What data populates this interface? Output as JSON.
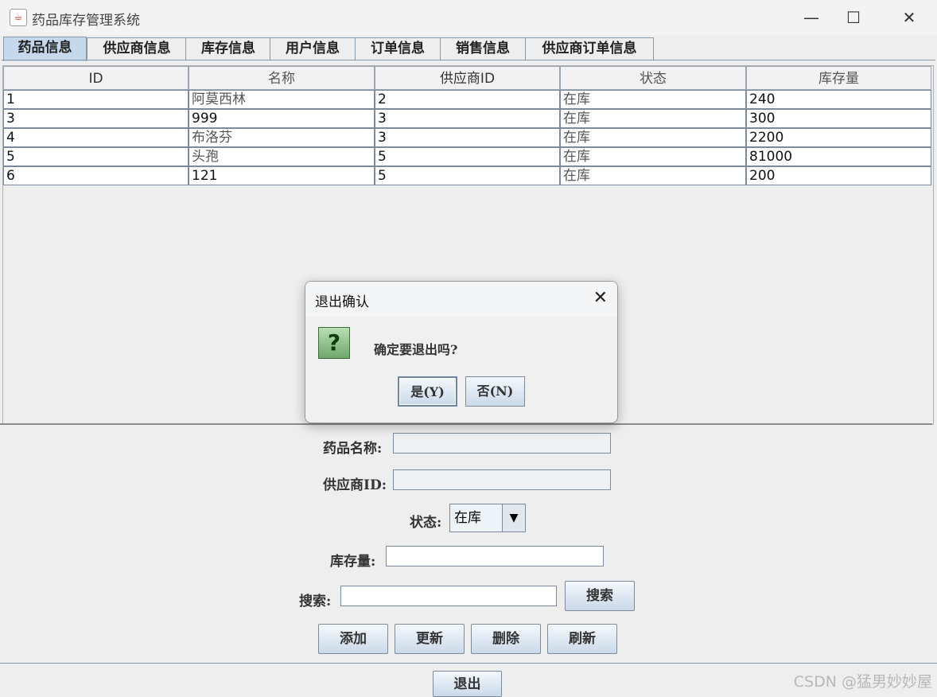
{
  "window": {
    "title": "药品库存管理系统",
    "minimize": "—",
    "maximize": "☐",
    "close": "✕"
  },
  "tabs": [
    "药品信息",
    "供应商信息",
    "库存信息",
    "用户信息",
    "订单信息",
    "销售信息",
    "供应商订单信息"
  ],
  "active_tab": "药品信息",
  "table": {
    "headers": [
      "ID",
      "名称",
      "供应商ID",
      "状态",
      "库存量"
    ],
    "rows": [
      [
        "1",
        "阿莫西林",
        "2",
        "在库",
        "240"
      ],
      [
        "3",
        "999",
        "3",
        "在库",
        "300"
      ],
      [
        "4",
        "布洛芬",
        "3",
        "在库",
        "2200"
      ],
      [
        "5",
        "头孢",
        "5",
        "在库",
        "81000"
      ],
      [
        "6",
        "121",
        "5",
        "在库",
        "200"
      ]
    ]
  },
  "form": {
    "name_label": "药品名称:",
    "supplier_label": "供应商ID:",
    "status_label": "状态:",
    "status_value": "在库",
    "stock_label": "库存量:",
    "search_label": "搜索:",
    "search_button": "搜索",
    "add_button": "添加",
    "update_button": "更新",
    "delete_button": "删除",
    "refresh_button": "刷新",
    "exit_button": "退出"
  },
  "dialog": {
    "title": "退出确认",
    "message": "确定要退出吗?",
    "yes_button": "是(Y)",
    "no_button": "否(N)",
    "icon": "question-icon"
  },
  "watermark": "CSDN @猛男妙妙屋"
}
